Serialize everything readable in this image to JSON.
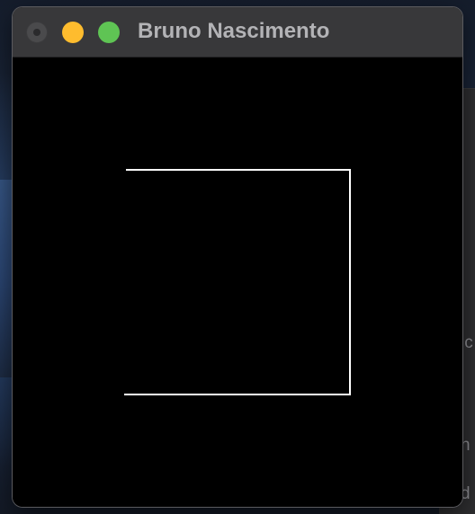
{
  "window": {
    "title": "Bruno Nascimento",
    "buttons": {
      "close": "close-icon",
      "minimize": "minimize-icon",
      "zoom": "zoom-icon"
    },
    "canvas_background": "#000000",
    "stroke_color": "#ffffff"
  },
  "background_window": {
    "text_fragments": [
      "ic",
      "n",
      "d"
    ]
  }
}
